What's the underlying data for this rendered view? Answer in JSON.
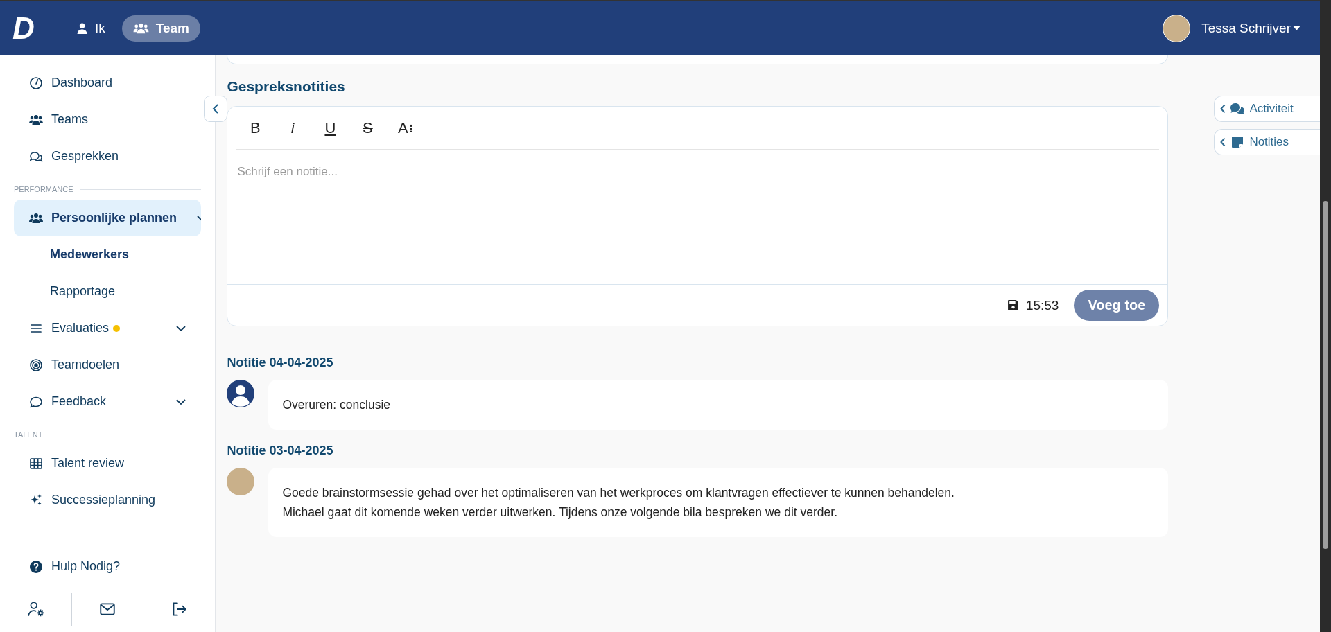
{
  "header": {
    "logo": "D",
    "nav": [
      {
        "label": "Ik",
        "selected": false
      },
      {
        "label": "Team",
        "selected": true
      }
    ],
    "user": {
      "name": "Tessa Schrijver"
    }
  },
  "sidebar": {
    "items": [
      {
        "kind": "item",
        "label": "Dashboard",
        "selected": false
      },
      {
        "kind": "item",
        "label": "Teams",
        "selected": false
      },
      {
        "kind": "item",
        "label": "Gesprekken",
        "selected": false
      },
      {
        "kind": "section",
        "label": "PERFORMANCE"
      },
      {
        "kind": "item",
        "label": "Persoonlijke plannen",
        "selected": true,
        "expandable": true
      },
      {
        "kind": "subitem",
        "label": "Medewerkers",
        "selected": true
      },
      {
        "kind": "subitem",
        "label": "Rapportage",
        "selected": false
      },
      {
        "kind": "item",
        "label": "Evaluaties",
        "selected": false,
        "expandable": true,
        "dot": true
      },
      {
        "kind": "item",
        "label": "Teamdoelen",
        "selected": false
      },
      {
        "kind": "item",
        "label": "Feedback",
        "selected": false,
        "expandable": true
      },
      {
        "kind": "section",
        "label": "TALENT"
      },
      {
        "kind": "item",
        "label": "Talent review",
        "selected": false
      },
      {
        "kind": "item",
        "label": "Successieplanning",
        "selected": false
      }
    ],
    "help": "Hulp Nodig?"
  },
  "section_title": "Gespreksnotities",
  "editor": {
    "toolbar": [
      {
        "kind": "bold",
        "label": "B"
      },
      {
        "kind": "italic",
        "label": "i"
      },
      {
        "kind": "underline",
        "label": "U"
      },
      {
        "kind": "strike",
        "label": "S"
      },
      {
        "kind": "size",
        "label": "A"
      }
    ],
    "placeholder": "Schrijf een notitie...",
    "saved_time": "15:53",
    "submit": "Voeg toe"
  },
  "notes": [
    {
      "title": "Notitie 04-04-2025",
      "text": "Overuren: conclusie"
    },
    {
      "title": "Notitie 03-04-2025",
      "text": "Goede brainstormsessie gehad over het optimaliseren van het werkproces om klantvragen effectiever te kunnen behandelen.\nMichael gaat dit komende weken verder uitwerken. Tijdens onze volgende bila bespreken we dit verder."
    }
  ],
  "side_tabs": [
    {
      "label": "Activiteit"
    },
    {
      "label": "Notities"
    }
  ]
}
